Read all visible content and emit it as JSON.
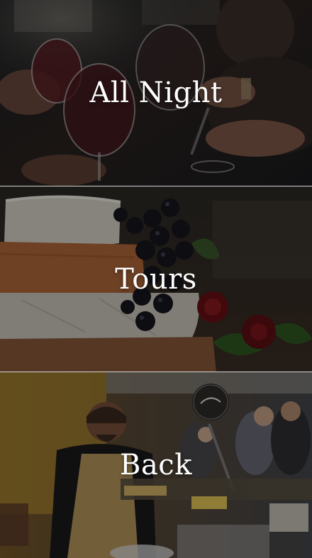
{
  "menu": {
    "items": [
      {
        "label": "All Night"
      },
      {
        "label": "Tours"
      },
      {
        "label": "Back"
      }
    ]
  },
  "colors": {
    "label": "#ffffff",
    "separator": "#e6e6e6",
    "overlay": "rgba(0,0,0,0.38)"
  },
  "images": [
    {
      "name": "wine-toast-photo"
    },
    {
      "name": "cheese-grapes-photo"
    },
    {
      "name": "food-stall-photo"
    }
  ]
}
